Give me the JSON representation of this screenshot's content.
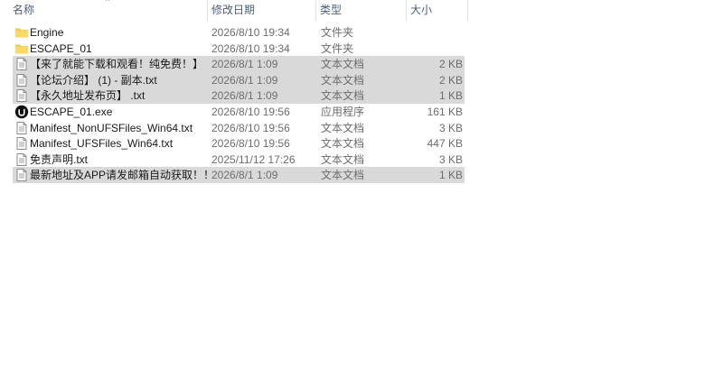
{
  "columns": {
    "name": "名称",
    "date": "修改日期",
    "type": "类型",
    "size": "大小"
  },
  "rows": [
    {
      "icon": "folder-icon",
      "name": "Engine",
      "date": "2026/8/10 19:34",
      "type": "文件夹",
      "size": "",
      "selected": false
    },
    {
      "icon": "folder-icon",
      "name": "ESCAPE_01",
      "date": "2026/8/10 19:34",
      "type": "文件夹",
      "size": "",
      "selected": false
    },
    {
      "icon": "text-file-icon",
      "name": "【来了就能下载和观看！纯免费！】 - 副...",
      "date": "2026/8/1 1:09",
      "type": "文本文档",
      "size": "2 KB",
      "selected": true
    },
    {
      "icon": "text-file-icon",
      "name": "【论坛介绍】 (1) - 副本.txt",
      "date": "2026/8/1 1:09",
      "type": "文本文档",
      "size": "2 KB",
      "selected": true
    },
    {
      "icon": "text-file-icon",
      "name": "【永久地址发布页】 .txt",
      "date": "2026/8/1 1:09",
      "type": "文本文档",
      "size": "1 KB",
      "selected": true
    },
    {
      "icon": "unreal-engine-icon",
      "name": "ESCAPE_01.exe",
      "date": "2026/8/10 19:56",
      "type": "应用程序",
      "size": "161 KB",
      "selected": false
    },
    {
      "icon": "text-file-icon",
      "name": "Manifest_NonUFSFiles_Win64.txt",
      "date": "2026/8/10 19:56",
      "type": "文本文档",
      "size": "3 KB",
      "selected": false
    },
    {
      "icon": "text-file-icon",
      "name": "Manifest_UFSFiles_Win64.txt",
      "date": "2026/8/10 19:56",
      "type": "文本文档",
      "size": "447 KB",
      "selected": false
    },
    {
      "icon": "text-file-icon",
      "name": "免责声明.txt",
      "date": "2025/11/12 17:26",
      "type": "文本文档",
      "size": "3 KB",
      "selected": false
    },
    {
      "icon": "text-file-icon",
      "name": "最新地址及APP请发邮箱自动获取！！！...",
      "date": "2026/8/1 1:09",
      "type": "文本文档",
      "size": "1 KB",
      "selected": true
    }
  ],
  "colors": {
    "selection": "#d9d9d9",
    "folder": "#f6c443",
    "header_text": "#4c607a",
    "secondary_text": "#6d6d6d"
  }
}
